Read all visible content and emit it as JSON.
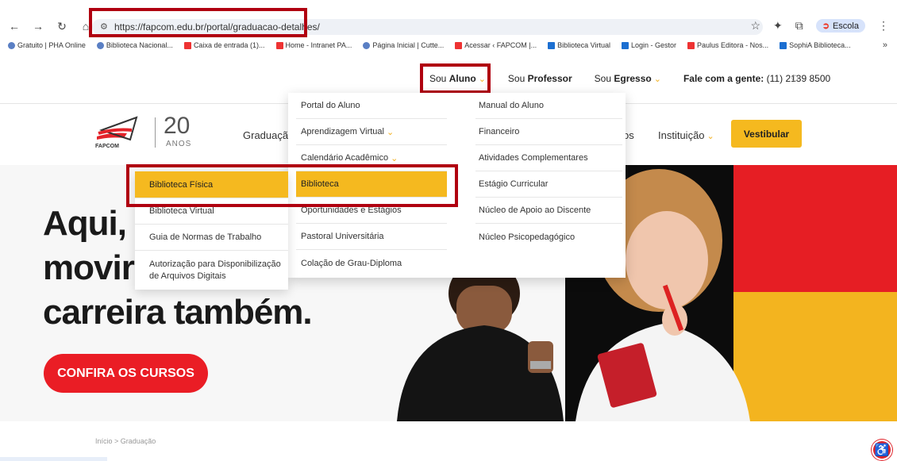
{
  "browser": {
    "url": "https://fapcom.edu.br/portal/graduacao-detalhes/",
    "profile_label": "Escola",
    "bookmarks": [
      "Gratuito | PHA Online",
      "Biblioteca Nacional...",
      "Caixa de entrada (1)...",
      "Home - Intranet PA...",
      "Página Inicial | Cutte...",
      "Acessar ‹ FAPCOM |...",
      "Biblioteca Virtual",
      "Login - Gestor",
      "Paulus Editora - Nos...",
      "SophiA Biblioteca..."
    ],
    "more_bookmarks": "»"
  },
  "topnav": {
    "aluno_prefix": "Sou",
    "aluno_bold": "Aluno",
    "professor_prefix": "Sou",
    "professor_bold": "Professor",
    "egresso_prefix": "Sou",
    "egresso_bold": "Egresso",
    "contact_bold": "Fale com a gente:",
    "contact_phone": "(11) 2139 8500"
  },
  "logo": {
    "brand": "FAPCOM",
    "number": "20",
    "anos": "ANOS"
  },
  "mainnav": {
    "graduacao": "Graduação",
    "os_fragment": "os",
    "instituicao": "Instituição",
    "vestibular": "Vestibular"
  },
  "dropdown": {
    "col1": [
      {
        "label": "Portal do Aluno",
        "chevron": false
      },
      {
        "label": "Aprendizagem Virtual",
        "chevron": true
      },
      {
        "label": "Calendário Acadêmico",
        "chevron": true
      },
      {
        "label": "Biblioteca",
        "chevron": false,
        "active": true
      },
      {
        "label": "Oportunidades e Estágios",
        "chevron": false
      },
      {
        "label": "Pastoral Universitária",
        "chevron": false
      },
      {
        "label": "Colação de Grau-Diploma",
        "chevron": false
      }
    ],
    "col2": [
      "Manual do Aluno",
      "Financeiro",
      "Atividades Complementares",
      "Estágio Curricular",
      "Núcleo de Apoio ao Discente",
      "Núcleo Psicopedagógico"
    ]
  },
  "submenu": {
    "items": [
      {
        "label": "Biblioteca Física",
        "active": true
      },
      {
        "label": "Biblioteca Virtual",
        "active": false
      },
      {
        "label": "Guia de Normas de Trabalho",
        "active": false
      },
      {
        "label": "Autorização para Disponibilização de Arquivos Digitais",
        "active": false
      }
    ]
  },
  "hero": {
    "line1": "Aqui, v",
    "line2": "movir",
    "line3": "carreira também.",
    "cta": "CONFIRA OS CURSOS"
  },
  "breadcrumb": "Início > Graduação",
  "colors": {
    "accent_yellow": "#f5b91f",
    "brand_red": "#ea1d25",
    "highlight_box": "#b00010"
  }
}
